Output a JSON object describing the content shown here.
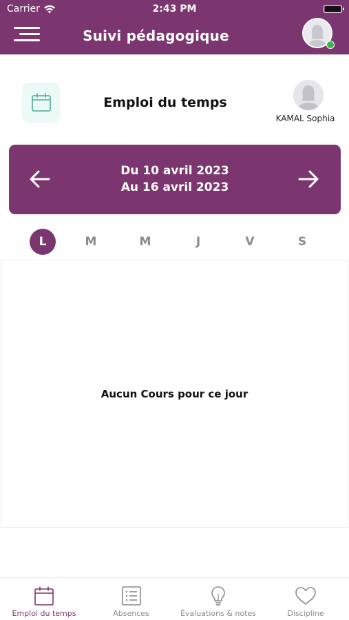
{
  "status_bar": {
    "carrier": "Carrier",
    "time": "2:43 PM"
  },
  "header": {
    "title": "Suivi pédagogique"
  },
  "page": {
    "title": "Emploi du temps",
    "student_name": "KAMAL Sophia"
  },
  "week": {
    "from": "Du 10 avril 2023",
    "to": "Au 16 avril 2023"
  },
  "days": [
    {
      "label": "L",
      "active": true
    },
    {
      "label": "M",
      "active": false
    },
    {
      "label": "M",
      "active": false
    },
    {
      "label": "J",
      "active": false
    },
    {
      "label": "V",
      "active": false
    },
    {
      "label": "S",
      "active": false
    }
  ],
  "content": {
    "empty_message": "Aucun Cours pour ce jour"
  },
  "tabs": [
    {
      "label": "Emploi du temps",
      "icon": "calendar-icon",
      "active": true
    },
    {
      "label": "Absences",
      "icon": "list-icon",
      "active": false
    },
    {
      "label": "Évaluations & notes",
      "icon": "lightbulb-icon",
      "active": false
    },
    {
      "label": "Discipline",
      "icon": "heart-icon",
      "active": false
    }
  ],
  "colors": {
    "brand": "#7b356f",
    "online": "#3cb54a",
    "tile": "#ecfaf7",
    "calendar_icon": "#5fb3a3",
    "inactive": "#8a8a8a"
  }
}
